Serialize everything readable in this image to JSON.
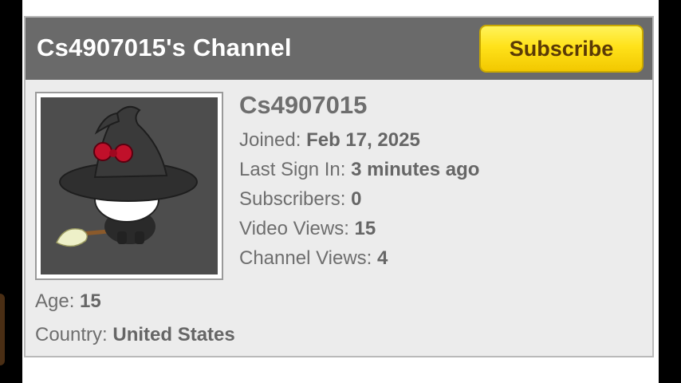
{
  "channel": {
    "title": "Cs4907015's Channel",
    "subscribe_label": "Subscribe",
    "username": "Cs4907015"
  },
  "stats": [
    {
      "label": "Joined: ",
      "value": "Feb 17, 2025"
    },
    {
      "label": "Last Sign In: ",
      "value": "3 minutes ago"
    },
    {
      "label": "Subscribers: ",
      "value": "0"
    },
    {
      "label": "Video Views: ",
      "value": "15"
    },
    {
      "label": "Channel Views: ",
      "value": "4"
    }
  ],
  "profile": {
    "age_label": "Age: ",
    "age_value": "15",
    "country_label": "Country: ",
    "country_value": "United States"
  },
  "avatar": {
    "icon": "witch-cat-avatar-icon",
    "background": "#4d4d4d"
  },
  "colors": {
    "header_bg": "#6a6a6a",
    "card_bg": "#ececec",
    "subscribe_bg": "#ffe21a",
    "subscribe_text": "#5a3a06",
    "text": "#6e6e6e"
  }
}
